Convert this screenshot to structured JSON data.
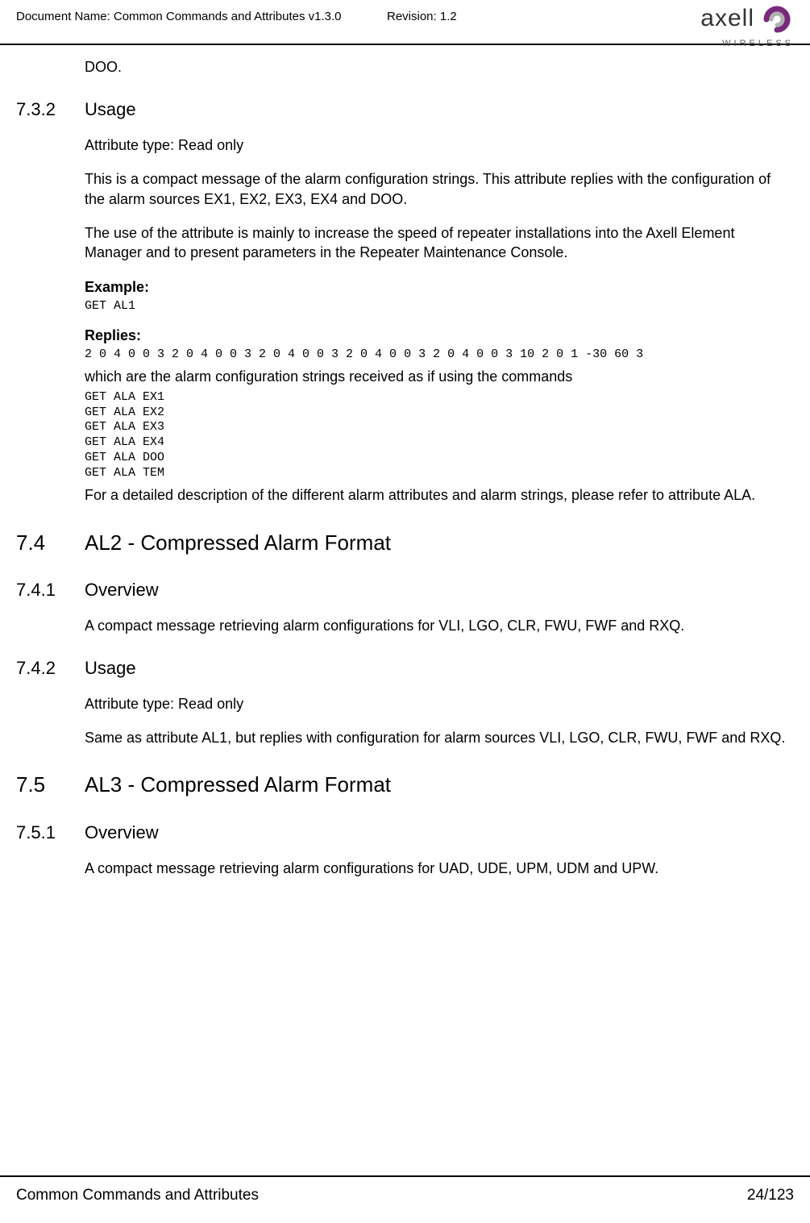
{
  "header": {
    "doc_name": "Document Name: Common Commands and Attributes v1.3.0",
    "revision": "Revision: 1.2",
    "logo_main": "axell",
    "logo_sub": "WIRELESS"
  },
  "continuation": "DOO.",
  "s732": {
    "num": "7.3.2",
    "title": "Usage",
    "attr_type": "Attribute type: Read only",
    "p1": "This is a compact message of the alarm configuration strings. This attribute replies with the configuration of the alarm sources EX1, EX2, EX3, EX4 and DOO.",
    "p2": "The use of the attribute is mainly to increase the speed of repeater installations into the Axell Element Manager and to present parameters in the Repeater Maintenance Console.",
    "example_label": "Example:",
    "example_code": "GET AL1",
    "replies_label": "Replies:",
    "replies_code": "2 0 4 0 0 3 2 0 4 0 0 3 2 0 4 0 0 3 2 0 4 0 0 3 2 0 4 0 0 3 10 2 0 1 -30 60 3",
    "p3": "which are the alarm configuration strings received as if using the commands",
    "commands": "GET ALA EX1\nGET ALA EX2\nGET ALA EX3\nGET ALA EX4\nGET ALA DOO\nGET ALA TEM",
    "p4": "For a detailed description of the different alarm attributes and alarm strings, please refer to attribute ALA."
  },
  "s74": {
    "num": "7.4",
    "title": "AL2 - Compressed Alarm Format"
  },
  "s741": {
    "num": "7.4.1",
    "title": "Overview",
    "p1": "A compact message retrieving alarm configurations for VLI, LGO, CLR, FWU, FWF and RXQ."
  },
  "s742": {
    "num": "7.4.2",
    "title": "Usage",
    "attr_type": "Attribute type: Read only",
    "p1": "Same as attribute AL1, but replies with configuration for alarm sources VLI, LGO, CLR, FWU, FWF and RXQ."
  },
  "s75": {
    "num": "7.5",
    "title": "AL3 - Compressed Alarm Format"
  },
  "s751": {
    "num": "7.5.1",
    "title": "Overview",
    "p1": "A compact message retrieving alarm configurations for UAD, UDE, UPM, UDM and UPW."
  },
  "footer": {
    "left": "Common Commands and Attributes",
    "right": "24/123"
  }
}
